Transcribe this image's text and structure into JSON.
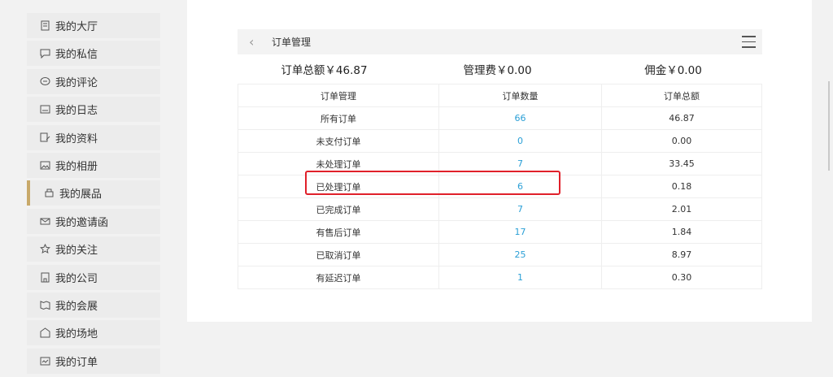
{
  "sidebar": {
    "items": [
      {
        "label": "我的大厅",
        "icon": "document-icon",
        "active": false
      },
      {
        "label": "我的私信",
        "icon": "message-icon",
        "active": false
      },
      {
        "label": "我的评论",
        "icon": "comment-icon",
        "active": false
      },
      {
        "label": "我的日志",
        "icon": "journal-icon",
        "active": false
      },
      {
        "label": "我的资料",
        "icon": "profile-edit-icon",
        "active": false
      },
      {
        "label": "我的相册",
        "icon": "album-icon",
        "active": false
      },
      {
        "label": "我的展品",
        "icon": "exhibit-icon",
        "active": true
      },
      {
        "label": "我的邀请函",
        "icon": "envelope-icon",
        "active": false
      },
      {
        "label": "我的关注",
        "icon": "star-icon",
        "active": false
      },
      {
        "label": "我的公司",
        "icon": "building-icon",
        "active": false
      },
      {
        "label": "我的会展",
        "icon": "map-icon",
        "active": false
      },
      {
        "label": "我的场地",
        "icon": "venue-icon",
        "active": false
      },
      {
        "label": "我的订单",
        "icon": "order-icon",
        "active": false
      }
    ]
  },
  "topbar": {
    "title": "订单管理",
    "back_icon": "chevron-left-icon",
    "menu_icon": "hamburger-menu-icon"
  },
  "summary": {
    "total": "订单总额￥46.87",
    "fee": "管理费￥0.00",
    "commission": "佣金￥0.00"
  },
  "table": {
    "headers": [
      "订单管理",
      "订单数量",
      "订单总额"
    ],
    "rows": [
      {
        "name": "所有订单",
        "count": "66",
        "amount": "46.87"
      },
      {
        "name": "未支付订单",
        "count": "0",
        "amount": "0.00"
      },
      {
        "name": "未处理订单",
        "count": "7",
        "amount": "33.45"
      },
      {
        "name": "已处理订单",
        "count": "6",
        "amount": "0.18"
      },
      {
        "name": "已完成订单",
        "count": "7",
        "amount": "2.01"
      },
      {
        "name": "有售后订单",
        "count": "17",
        "amount": "1.84"
      },
      {
        "name": "已取消订单",
        "count": "25",
        "amount": "8.97"
      },
      {
        "name": "有延迟订单",
        "count": "1",
        "amount": "0.30"
      }
    ]
  },
  "colors": {
    "accent": "#c8a96a",
    "link": "#2a9fd6",
    "highlight": "#e0202a"
  }
}
